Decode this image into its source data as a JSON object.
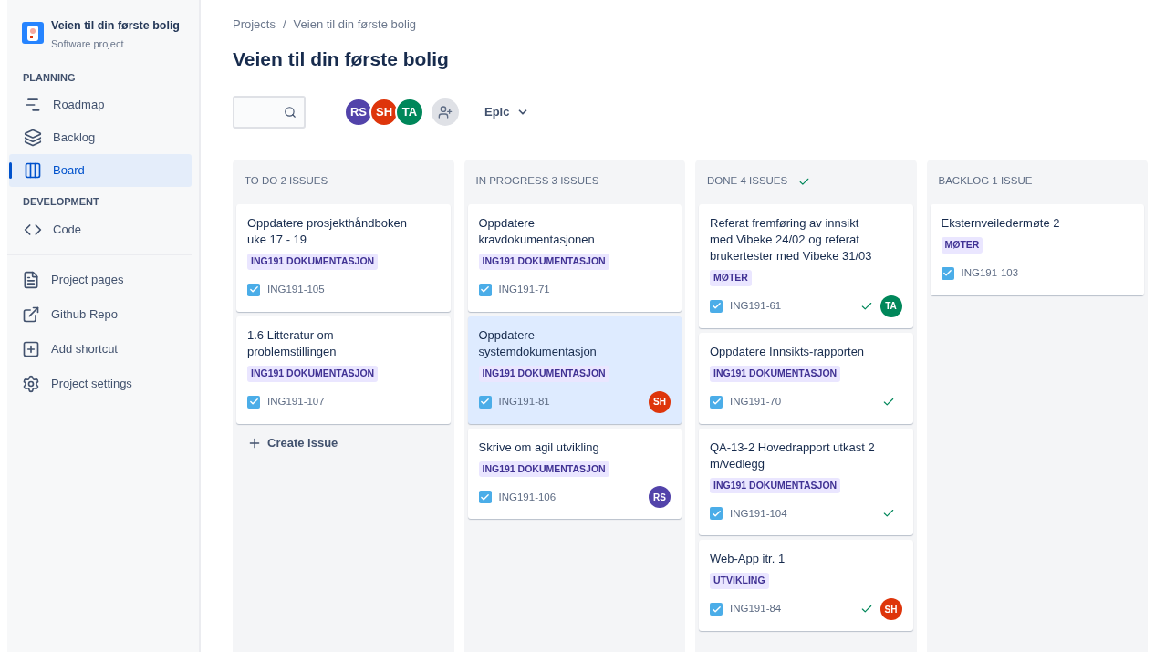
{
  "project": {
    "name": "Veien til din første bolig",
    "type": "Software project"
  },
  "sidebar": {
    "sections": [
      {
        "heading": "PLANNING",
        "items": [
          {
            "kind": "roadmap",
            "label": "Roadmap",
            "selected": false
          },
          {
            "kind": "backlog",
            "label": "Backlog",
            "selected": false
          },
          {
            "kind": "board",
            "label": "Board",
            "selected": true
          }
        ]
      },
      {
        "heading": "DEVELOPMENT",
        "items": [
          {
            "kind": "code",
            "label": "Code",
            "selected": false
          }
        ]
      }
    ],
    "links": [
      {
        "kind": "page",
        "label": "Project pages"
      },
      {
        "kind": "external",
        "label": "Github Repo"
      },
      {
        "kind": "add",
        "label": "Add shortcut"
      },
      {
        "kind": "gear",
        "label": "Project settings"
      }
    ]
  },
  "breadcrumbs": [
    "Projects",
    "Veien til din første bolig"
  ],
  "breadcrumb_separator": "/",
  "title": "Veien til din første bolig",
  "filters": {
    "avatars": [
      {
        "initials": "RS",
        "color": "#5243aa"
      },
      {
        "initials": "SH",
        "color": "#de350b"
      },
      {
        "initials": "TA",
        "color": "#00875a"
      }
    ],
    "epic": "Epic"
  },
  "columns": [
    {
      "title": "TO DO 2 ISSUES",
      "done": false,
      "create_issue": "Create issue",
      "cards": [
        {
          "title": "Oppdatere prosjekthåndboken uke 17 - 19",
          "epic": "ING191 DOKUMENTASJON",
          "key": "ING191-105",
          "selected": false,
          "resolved": false
        },
        {
          "title": "1.6 Litteratur om problemstillingen",
          "epic": "ING191 DOKUMENTASJON",
          "key": "ING191-107",
          "selected": false,
          "resolved": false
        }
      ]
    },
    {
      "title": "IN PROGRESS 3 ISSUES",
      "done": false,
      "cards": [
        {
          "title": "Oppdatere kravdokumentasjonen",
          "epic": "ING191 DOKUMENTASJON",
          "key": "ING191-71",
          "selected": false,
          "resolved": false
        },
        {
          "title": "Oppdatere systemdokumentasjon",
          "epic": "ING191 DOKUMENTASJON",
          "key": "ING191-81",
          "selected": true,
          "resolved": false,
          "assignee": {
            "initials": "SH",
            "color": "#de350b"
          }
        },
        {
          "title": "Skrive om agil utvikling",
          "epic": "ING191 DOKUMENTASJON",
          "key": "ING191-106",
          "selected": false,
          "resolved": false,
          "assignee": {
            "initials": "RS",
            "color": "#5243aa"
          }
        }
      ]
    },
    {
      "title": "DONE 4 ISSUES",
      "done": true,
      "cards": [
        {
          "title": "Referat fremføring av innsikt med Vibeke 24/02 og referat brukertester med Vibeke 31/03",
          "epic": "MØTER",
          "key": "ING191-61",
          "selected": false,
          "resolved": true,
          "assignee": {
            "initials": "TA",
            "color": "#00875a"
          }
        },
        {
          "title": "Oppdatere Innsikts-rapporten",
          "epic": "ING191 DOKUMENTASJON",
          "key": "ING191-70",
          "selected": false,
          "resolved": true
        },
        {
          "title": "QA-13-2 Hovedrapport utkast 2 m/vedlegg",
          "epic": "ING191 DOKUMENTASJON",
          "key": "ING191-104",
          "selected": false,
          "resolved": true
        },
        {
          "title": "Web-App itr. 1",
          "epic": "UTVIKLING",
          "key": "ING191-84",
          "selected": false,
          "resolved": true,
          "assignee": {
            "initials": "SH",
            "color": "#de350b"
          }
        }
      ]
    },
    {
      "title": "BACKLOG 1 ISSUE",
      "done": false,
      "cards": [
        {
          "title": "Eksternveiledermøte 2",
          "epic": "MØTER",
          "key": "ING191-103",
          "selected": false,
          "resolved": false
        }
      ]
    }
  ]
}
